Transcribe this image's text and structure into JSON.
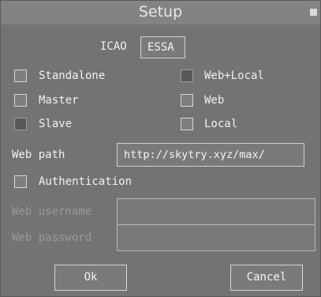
{
  "window": {
    "title": "Setup"
  },
  "icao": {
    "label": "ICAO",
    "value": "ESSA"
  },
  "modes": {
    "standalone": {
      "label": "Standalone",
      "checked": false
    },
    "master": {
      "label": "Master",
      "checked": false
    },
    "slave": {
      "label": "Slave",
      "checked": true
    },
    "web_local": {
      "label": "Web+Local",
      "checked": true
    },
    "web": {
      "label": "Web",
      "checked": false
    },
    "local": {
      "label": "Local",
      "checked": false
    }
  },
  "web_path": {
    "label": "Web path",
    "value": "http://skytry.xyz/max/"
  },
  "authentication": {
    "label": "Authentication",
    "checked": false
  },
  "web_username": {
    "label": "Web username",
    "value": ""
  },
  "web_password": {
    "label": "Web password",
    "value": ""
  },
  "buttons": {
    "ok": "Ok",
    "cancel": "Cancel"
  }
}
